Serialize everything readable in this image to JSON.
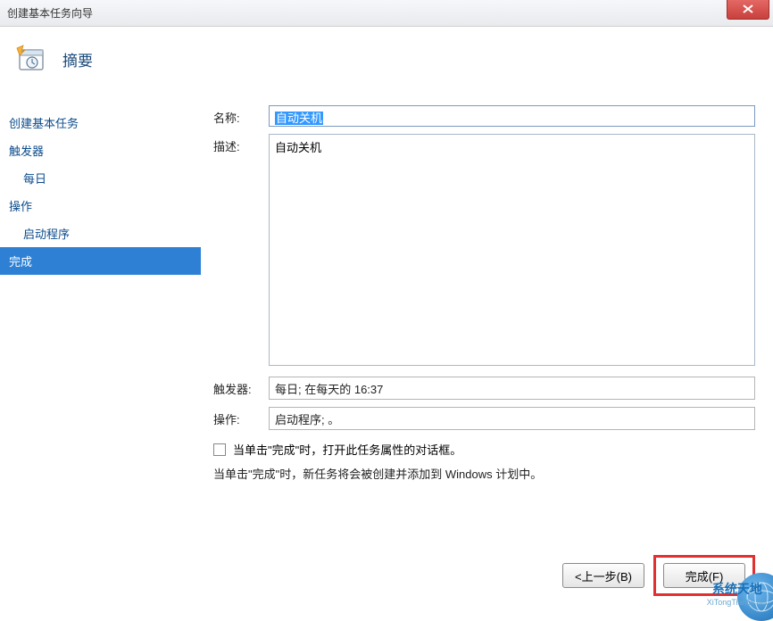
{
  "window": {
    "title": "创建基本任务向导"
  },
  "header": {
    "title": "摘要"
  },
  "sidebar": {
    "items": [
      {
        "label": "创建基本任务",
        "indent": false,
        "link": true
      },
      {
        "label": "触发器",
        "indent": false,
        "link": true
      },
      {
        "label": "每日",
        "indent": true,
        "link": true
      },
      {
        "label": "操作",
        "indent": false,
        "link": true
      },
      {
        "label": "启动程序",
        "indent": true,
        "link": true
      },
      {
        "label": "完成",
        "indent": false,
        "selected": true
      }
    ]
  },
  "form": {
    "name_label": "名称:",
    "name_value": "自动关机",
    "desc_label": "描述:",
    "desc_value": "自动关机",
    "trigger_label": "触发器:",
    "trigger_value": "每日; 在每天的 16:37",
    "action_label": "操作:",
    "action_value": "启动程序; 。",
    "checkbox_label": "当单击\"完成\"时，打开此任务属性的对话框。",
    "info": "当单击\"完成\"时，新任务将会被创建并添加到 Windows 计划中。"
  },
  "buttons": {
    "back": "<上一步(B)",
    "finish": "完成(F)"
  },
  "watermark": {
    "cn": "系统天地",
    "en": "XiTongTianDi.net"
  }
}
